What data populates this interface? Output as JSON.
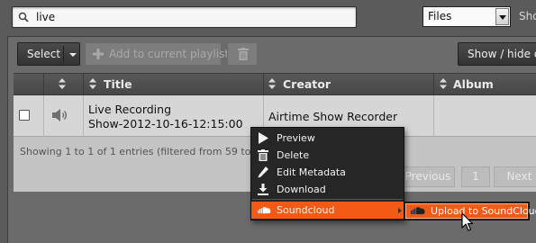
{
  "search": {
    "value": "live"
  },
  "type_filter": {
    "selected": "Files",
    "show_label": "Sho"
  },
  "toolbar": {
    "select_label": "Select",
    "add_playlist_label": "Add to current playlist",
    "show_hide_label": "Show / hide co"
  },
  "table": {
    "headers": {
      "title": "Title",
      "creator": "Creator",
      "album": "Album"
    },
    "row": {
      "title_line1": "Live Recording",
      "title_line2": "Show-2012-10-16-12:15:00",
      "creator": "Airtime Show Recorder"
    },
    "entries_info": "Showing 1 to 1 of 1 entries (filtered from 59 tota",
    "pagination": {
      "previous": "Previous",
      "page": "1",
      "next": "Next"
    }
  },
  "context_menu": {
    "items": [
      "Preview",
      "Delete",
      "Edit Metadata",
      "Download",
      "Soundcloud"
    ],
    "submenu_item": "Upload to SoundCloud"
  },
  "colors": {
    "accent": "#f25a15",
    "menu_bg": "#262626"
  }
}
